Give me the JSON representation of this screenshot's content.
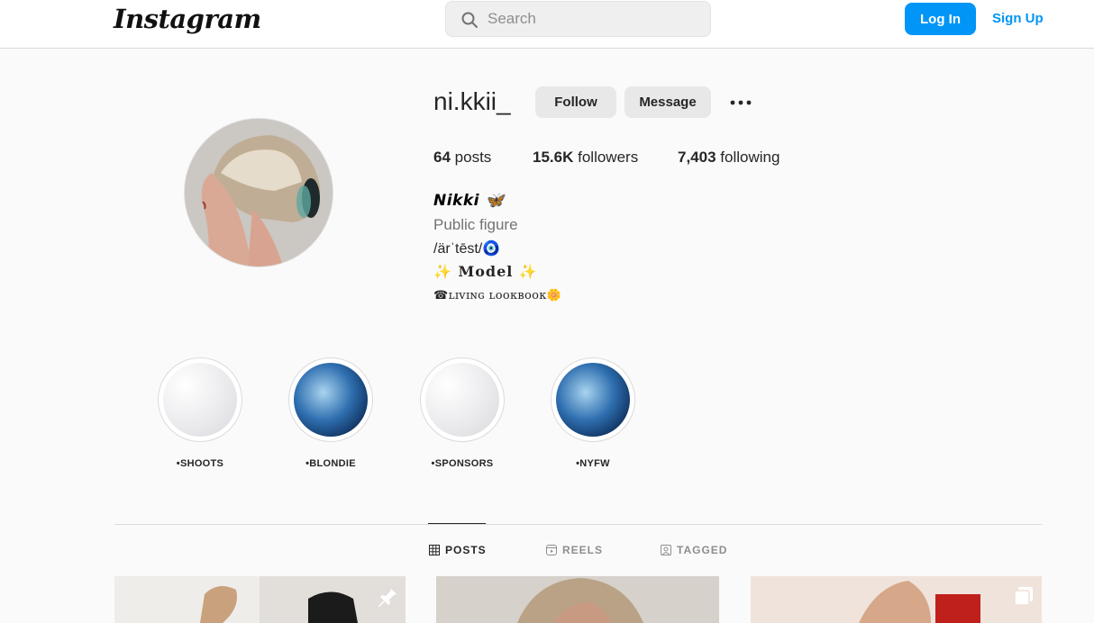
{
  "nav": {
    "logo": "Instagram",
    "search_placeholder": "Search",
    "login_label": "Log In",
    "signup_label": "Sign Up"
  },
  "profile": {
    "username": "ni.kkii_",
    "follow_label": "Follow",
    "message_label": "Message",
    "stats": {
      "posts_count": "64",
      "posts_label": "posts",
      "followers_count": "15.6K",
      "followers_label": "followers",
      "following_count": "7,403",
      "following_label": "following"
    },
    "bio": {
      "name": "𝙉𝙞𝙠𝙠𝙞 🦋",
      "category": "Public figure",
      "line1": "/ärˈtēst/🧿",
      "line2": "✨ 𝐌𝐨𝐝𝐞𝐥 ✨",
      "line3": "☎ʟɪᴠɪɴɢ ʟᴏᴏᴋʙᴏᴏᴋ🌼"
    }
  },
  "highlights": [
    {
      "label": "•SHOOTS",
      "style": "marble"
    },
    {
      "label": "•BLONDIE",
      "style": "wave"
    },
    {
      "label": "•SPONSORS",
      "style": "marble"
    },
    {
      "label": "•NYFW",
      "style": "wave"
    }
  ],
  "tabs": [
    {
      "label": "POSTS",
      "icon": "grid-icon",
      "active": true
    },
    {
      "label": "REELS",
      "icon": "reels-icon",
      "active": false
    },
    {
      "label": "TAGGED",
      "icon": "tagged-icon",
      "active": false
    }
  ],
  "colors": {
    "accent": "#0095f6",
    "background": "#fafafa"
  }
}
